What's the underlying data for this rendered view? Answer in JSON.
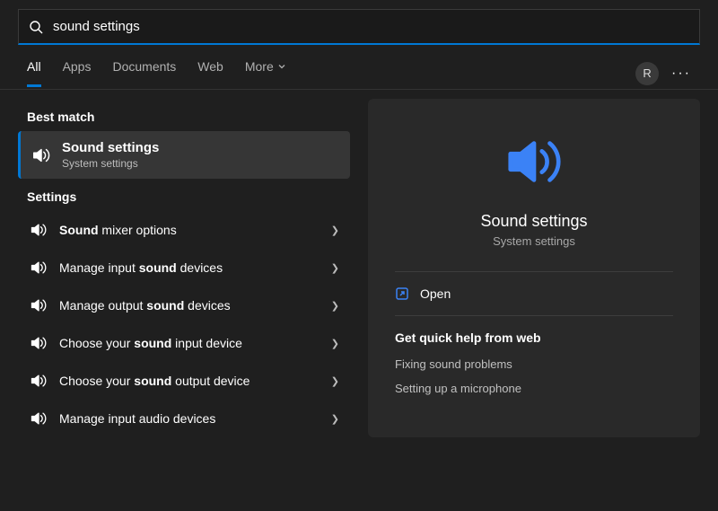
{
  "search": {
    "query": "sound settings"
  },
  "tabs": {
    "all": "All",
    "apps": "Apps",
    "documents": "Documents",
    "web": "Web",
    "more": "More"
  },
  "user": {
    "initial": "R"
  },
  "left": {
    "best_match_header": "Best match",
    "best_match": {
      "title": "Sound settings",
      "subtitle": "System settings"
    },
    "settings_header": "Settings",
    "items": [
      {
        "html": "<b>Sound</b> mixer options"
      },
      {
        "html": "Manage input <b>sound</b> devices"
      },
      {
        "html": "Manage output <b>sound</b> devices"
      },
      {
        "html": "Choose your <b>sound</b> input device"
      },
      {
        "html": "Choose your <b>sound</b> output device"
      },
      {
        "html": "Manage input audio devices"
      }
    ]
  },
  "detail": {
    "title": "Sound settings",
    "subtitle": "System settings",
    "open": "Open",
    "help_header": "Get quick help from web",
    "help_links": [
      "Fixing sound problems",
      "Setting up a microphone"
    ]
  }
}
